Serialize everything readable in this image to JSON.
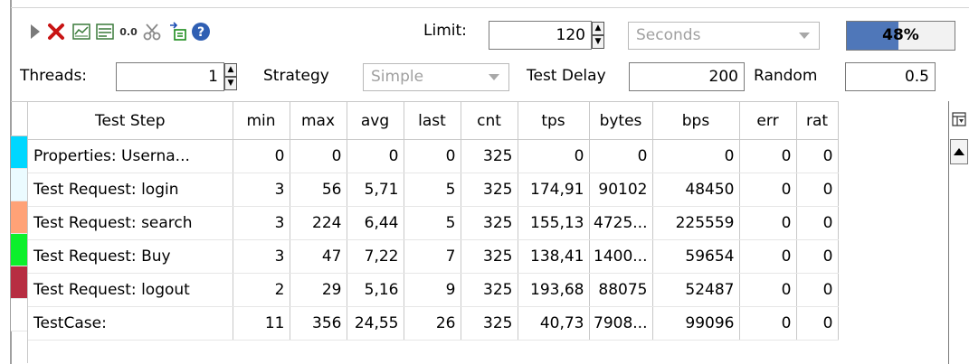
{
  "toolbar": {
    "icons": [
      "run-icon",
      "cancel-icon",
      "graph-icon",
      "statistics-history-icon",
      "reset-icon",
      "options-icon",
      "export-icon",
      "help-icon"
    ],
    "reset_text": "0.0",
    "limit_label": "Limit:",
    "limit_value": "120",
    "limit_unit": "Seconds",
    "progress_text": "48%",
    "progress_fraction": 0.48,
    "progress_color": "#4f77b9"
  },
  "settings": {
    "threads_label": "Threads:",
    "threads_value": "1",
    "strategy_label": "Strategy",
    "strategy_value": "Simple",
    "test_delay_label": "Test Delay",
    "test_delay_value": "200",
    "random_label": "Random",
    "random_value": "0.5"
  },
  "table": {
    "headers": [
      "Test Step",
      "min",
      "max",
      "avg",
      "last",
      "cnt",
      "tps",
      "bytes",
      "bps",
      "err",
      "rat"
    ],
    "rows": [
      {
        "color": "#00d7ff",
        "cells": [
          "Properties: Userna...",
          "0",
          "0",
          "0",
          "0",
          "325",
          "0",
          "0",
          "0",
          "0",
          "0"
        ]
      },
      {
        "color": "#ebfbff",
        "cells": [
          "Test Request: login",
          "3",
          "56",
          "5,71",
          "5",
          "325",
          "174,91",
          "90102",
          "48450",
          "0",
          "0"
        ]
      },
      {
        "color": "#ffa277",
        "cells": [
          "Test Request: search",
          "3",
          "224",
          "6,44",
          "5",
          "325",
          "155,13",
          "4725...",
          "225559",
          "0",
          "0"
        ]
      },
      {
        "color": "#0cf02c",
        "cells": [
          "Test Request: Buy",
          "3",
          "47",
          "7,22",
          "7",
          "325",
          "138,41",
          "1400...",
          "59654",
          "0",
          "0"
        ]
      },
      {
        "color": "#b72e42",
        "cells": [
          "Test Request: logout",
          "2",
          "29",
          "5,16",
          "9",
          "325",
          "193,68",
          "88075",
          "52487",
          "0",
          "0"
        ]
      },
      {
        "color": "#ffffff",
        "cells": [
          "TestCase:",
          "11",
          "356",
          "24,55",
          "26",
          "325",
          "40,73",
          "7908...",
          "99096",
          "0",
          "0"
        ]
      }
    ]
  }
}
